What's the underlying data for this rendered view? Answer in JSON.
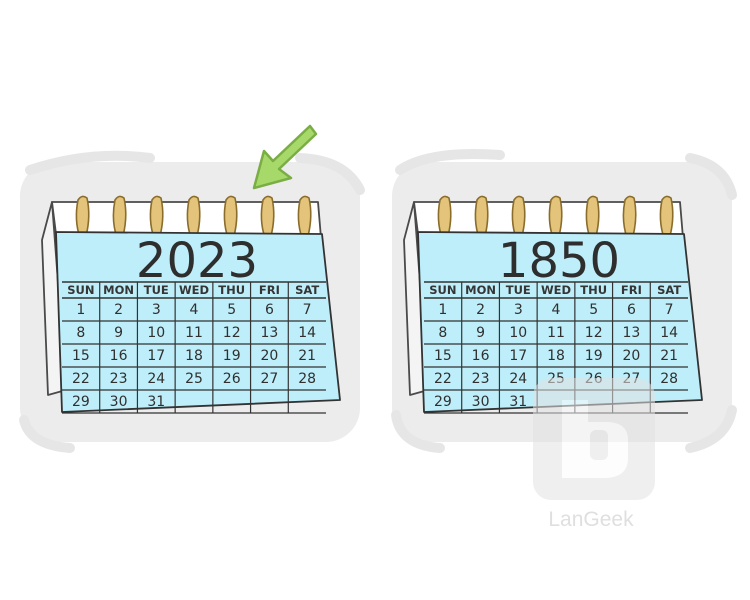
{
  "calendars": [
    {
      "year": "2023",
      "highlighted": true,
      "day_names": [
        "SUN",
        "MON",
        "TUE",
        "WED",
        "THU",
        "FRI",
        "SAT"
      ],
      "days": [
        "1",
        "2",
        "3",
        "4",
        "5",
        "6",
        "7",
        "8",
        "9",
        "10",
        "11",
        "12",
        "13",
        "14",
        "15",
        "16",
        "17",
        "18",
        "19",
        "20",
        "21",
        "22",
        "23",
        "24",
        "25",
        "26",
        "27",
        "28",
        "29",
        "30",
        "31"
      ]
    },
    {
      "year": "1850",
      "highlighted": false,
      "day_names": [
        "SUN",
        "MON",
        "TUE",
        "WED",
        "THU",
        "FRI",
        "SAT"
      ],
      "days": [
        "1",
        "2",
        "3",
        "4",
        "5",
        "6",
        "7",
        "8",
        "9",
        "10",
        "11",
        "12",
        "13",
        "14",
        "15",
        "16",
        "17",
        "18",
        "19",
        "20",
        "21",
        "22",
        "23",
        "24",
        "25",
        "26",
        "27",
        "28",
        "29",
        "30",
        "31"
      ]
    }
  ],
  "watermark": {
    "text": "LanGeek"
  },
  "colors": {
    "sheet": "#bdeef9",
    "grid_line": "#333333",
    "ring": "#d9b86a",
    "arrow": "#a7d96a",
    "frame": "#ececec"
  },
  "icons": [
    "arrow-icon",
    "binding-ring-icon",
    "langeek-logo-icon"
  ]
}
